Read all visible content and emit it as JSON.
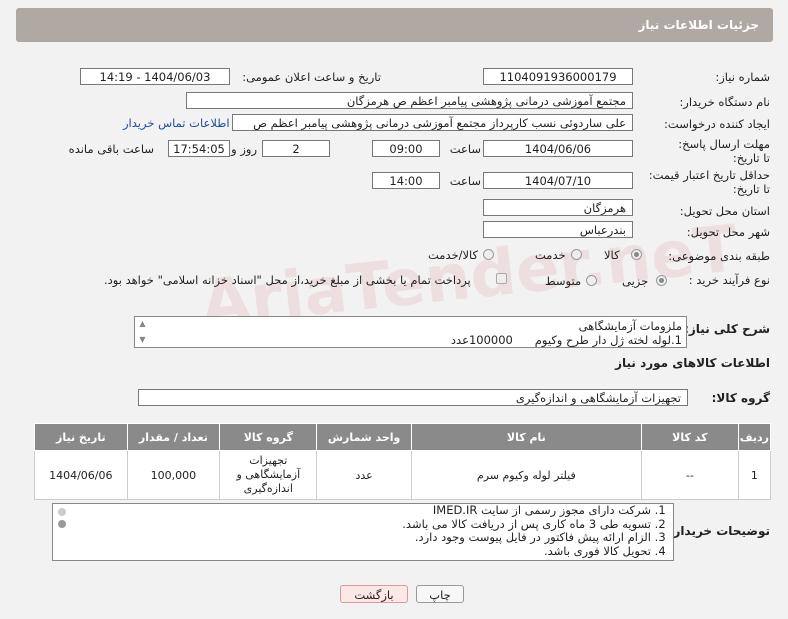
{
  "header": {
    "title": "جزئیات اطلاعات نیاز"
  },
  "fields": {
    "need_number_label": "شماره نیاز:",
    "need_number": "1104091936000179",
    "announce_label": "تاریخ و ساعت اعلان عمومی:",
    "announce_value": "1404/06/03 - 14:19",
    "buyer_label": "نام دستگاه خریدار:",
    "buyer_value": "مجتمع آموزشی درمانی پژوهشی پیامبر اعظم ص  هرمزگان",
    "creator_label": "ایجاد کننده درخواست:",
    "creator_value": "علی ساردوئی نسب کارپرداز مجتمع آموزشی درمانی پژوهشی پیامبر اعظم ص",
    "contact_link": "اطلاعات تماس خریدار",
    "deadline_label": "مهلت ارسال پاسخ: تا تاریخ:",
    "deadline_date": "1404/06/06",
    "time_label": "ساعت",
    "deadline_time": "09:00",
    "days_value": "2",
    "days_label": "روز و",
    "remaining_time": "17:54:05",
    "remaining_label": "ساعت باقی مانده",
    "validity_label": "حداقل تاریخ اعتبار قیمت: تا تاریخ:",
    "validity_date": "1404/07/10",
    "validity_time": "14:00",
    "province_label": "استان محل تحویل:",
    "province_value": "هرمزگان",
    "city_label": "شهر محل تحویل:",
    "city_value": "بندرعباس",
    "category_label": "طبقه بندی موضوعی:",
    "category_options": [
      "کالا",
      "خدمت",
      "کالا/خدمت"
    ],
    "process_label": "نوع فرآیند خرید :",
    "process_options": [
      "جزیی",
      "متوسط"
    ],
    "payment_note": "پرداخت تمام یا بخشی از مبلغ خرید،از محل \"اسناد خزانه اسلامی\" خواهد بود."
  },
  "description": {
    "label": "شرح کلی نیاز:",
    "line1": "ملزومات آزمایشگاهی",
    "line2": "1.لوله لخته ژل دار طرح وکیوم      100000عدد"
  },
  "goods_info_title": "اطلاعات کالاهای مورد نیاز",
  "goods_group": {
    "label": "گروه کالا:",
    "value": "تجهیزات آزمایشگاهی و اندازه‌گیری"
  },
  "table": {
    "headers": [
      "ردیف",
      "کد کالا",
      "نام کالا",
      "واحد شمارش",
      "گروه کالا",
      "تعداد / مقدار",
      "تاریخ نیاز"
    ],
    "rows": [
      {
        "row": "1",
        "code": "--",
        "name": "فیلتر لوله وکیوم سرم",
        "unit": "عدد",
        "group": "تجهیزات آزمایشگاهی و اندازه‌گیری",
        "qty": "100,000",
        "date": "1404/06/06"
      }
    ]
  },
  "buyer_notes": {
    "label": "توضیحات خریدار:",
    "items": [
      "شرکت دارای مجوز رسمی از سایت IMED.IR",
      "تسویه طی 3 ماه  کاری پس از دریافت کالا می باشد.",
      "الزام ارائه پیش فاکتور در فایل پیوست وجود دارد.",
      "تحویل کالا فوری باشد."
    ]
  },
  "buttons": {
    "print": "چاپ",
    "back": "بازگشت"
  },
  "watermark": "AriaTender.neT"
}
